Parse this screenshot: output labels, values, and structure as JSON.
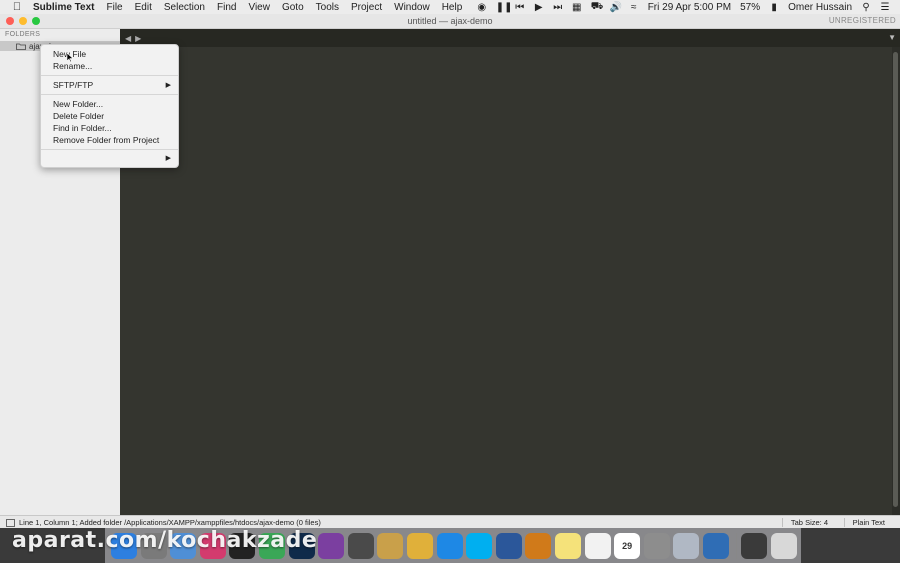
{
  "menubar": {
    "app_name": "Sublime Text",
    "items": [
      "File",
      "Edit",
      "Selection",
      "Find",
      "View",
      "Goto",
      "Tools",
      "Project",
      "Window",
      "Help"
    ],
    "datetime": "Fri 29 Apr  5:00 PM",
    "battery": "57%",
    "user": "Omer Hussain"
  },
  "window": {
    "title": "untitled — ajax-demo",
    "unregistered": "UNREGISTERED",
    "traffic_colors": [
      "#fe5f57",
      "#febc2e",
      "#28c840"
    ]
  },
  "sidebar": {
    "header": "FOLDERS",
    "folder": "ajax-demo"
  },
  "context_menu": {
    "items": [
      {
        "label": "New File"
      },
      {
        "label": "Rename..."
      },
      {
        "label": "SFTP/FTP"
      },
      {
        "label": "New Folder..."
      },
      {
        "label": "Delete Folder"
      },
      {
        "label": "Find in Folder..."
      },
      {
        "label": "Remove Folder from Project"
      }
    ]
  },
  "statusbar": {
    "message": "Line 1, Column 1; Added folder /Applications/XAMPP/xamppfiles/htdocs/ajax-demo (0 files)",
    "tab_size": "Tab Size: 4",
    "syntax": "Plain Text"
  },
  "watermark": "aparat.com/kochakzade",
  "dock": {
    "icons": [
      {
        "name": "finder-icon",
        "color": "#2d7fe0"
      },
      {
        "name": "launchpad-icon",
        "color": "#7a7a7a"
      },
      {
        "name": "keynote-icon",
        "color": "#4f8fd6"
      },
      {
        "name": "skype-icon",
        "color": "#d33b6e"
      },
      {
        "name": "terminal-icon",
        "color": "#222222"
      },
      {
        "name": "chrome-icon",
        "color": "#3aa757"
      },
      {
        "name": "photoshop-icon",
        "color": "#0f2a4a"
      },
      {
        "name": "phpstorm-icon",
        "color": "#7b3fa0"
      },
      {
        "name": "sublime-text-icon",
        "color": "#4a4a4a"
      },
      {
        "name": "archive-icon",
        "color": "#c9a04a"
      },
      {
        "name": "coins-icon",
        "color": "#e0b03a"
      },
      {
        "name": "teamviewer-icon",
        "color": "#1e88e5"
      },
      {
        "name": "skype-blue-icon",
        "color": "#00aff0"
      },
      {
        "name": "word-icon",
        "color": "#2b579a"
      },
      {
        "name": "dvd-player-icon",
        "color": "#d07a1a"
      },
      {
        "name": "notes-icon",
        "color": "#f5e27a"
      },
      {
        "name": "reminders-icon",
        "color": "#f2f2f2"
      },
      {
        "name": "calendar-icon",
        "color": "#ffffff"
      },
      {
        "name": "system-preferences-icon",
        "color": "#8d8d8d"
      },
      {
        "name": "settings-gear-icon",
        "color": "#b0b8c4"
      },
      {
        "name": "quicktime-icon",
        "color": "#2f6db5"
      },
      {
        "name": "simulator-icon",
        "color": "#3a3a3a"
      },
      {
        "name": "trash-icon",
        "color": "#d8d8d8"
      }
    ],
    "calendar_day": "29"
  }
}
